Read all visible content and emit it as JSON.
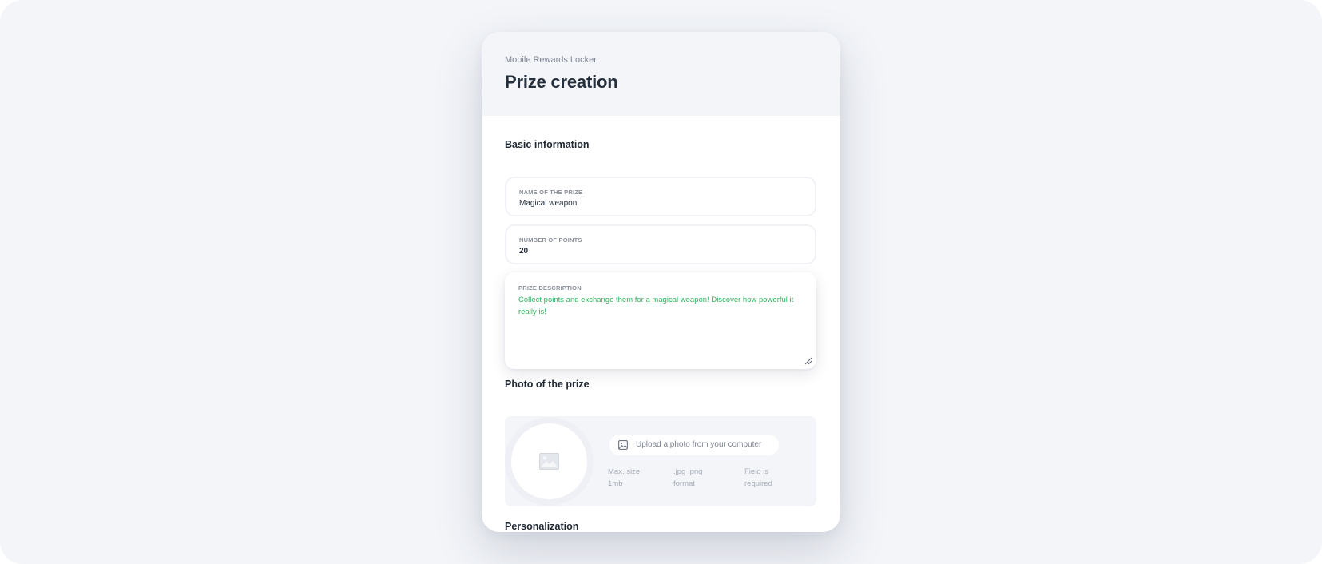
{
  "app": {
    "name": "Mobile Rewards Locker",
    "page_title": "Prize creation"
  },
  "basic_info": {
    "title": "Basic information",
    "prize_name": {
      "label": "NAME OF THE PRIZE",
      "value": "Magical weapon"
    },
    "points": {
      "label": "NUMBER OF POINTS",
      "value": "20"
    },
    "description": {
      "label": "PRIZE DESCRIPTION",
      "value": "Collect points and exchange them for a magical weapon! Discover how powerful it really is!"
    }
  },
  "photo": {
    "title": "Photo of the prize",
    "upload_label": "Upload a photo from your computer",
    "hints": {
      "size_line1": "Max. size",
      "size_line2": "1mb",
      "format_line1": ".jpg .png",
      "format_line2": "format",
      "required_line1": "Field is",
      "required_line2": "required"
    }
  },
  "personalization": {
    "title": "Personalization"
  },
  "colors": {
    "background": "#f3f5f9",
    "card": "#ffffff",
    "title_text": "#25303c",
    "description_text": "#2fb35a",
    "muted_text": "#a5acb8"
  },
  "icons": {
    "photo_placeholder": "image-placeholder-icon",
    "upload": "image-upload-icon",
    "resize": "resize-handle-icon"
  }
}
